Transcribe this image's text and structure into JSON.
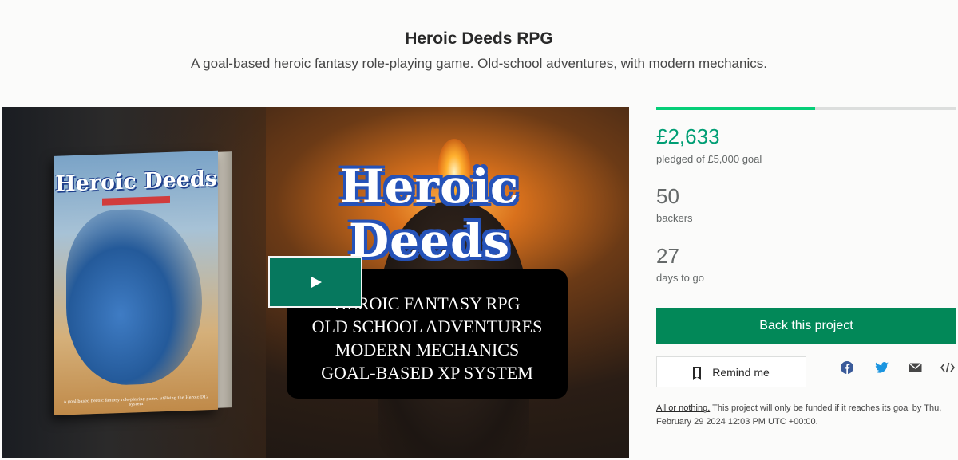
{
  "project": {
    "title": "Heroic Deeds RPG",
    "subtitle": "A goal-based heroic fantasy role-playing game. Old-school adventures, with modern mechanics."
  },
  "media": {
    "book_title": "Heroic Deeds",
    "book_tagline": "A goal-based heroic fantasy role-playing game, utilising the Heroic D12 system",
    "logo_text": "Heroic Deeds",
    "features": [
      "HEROIC FANTASY RPG",
      "OLD SCHOOL ADVENTURES",
      "MODERN MECHANICS",
      "GOAL-BASED XP SYSTEM"
    ],
    "play_icon": "play-icon"
  },
  "stats": {
    "progress_fraction": 0.53,
    "pledged_value": "£2,633",
    "pledged_label": "pledged of £5,000 goal",
    "backers_value": "50",
    "backers_label": "backers",
    "days_value": "27",
    "days_label": "days to go"
  },
  "actions": {
    "back_label": "Back this project",
    "remind_label": "Remind me",
    "share_icons": [
      "facebook-icon",
      "twitter-icon",
      "email-icon",
      "embed-icon"
    ]
  },
  "disclaimer": {
    "link_text": "All or nothing.",
    "text": " This project will only be funded if it reaches its goal by Thu, February 29 2024 12:03 PM UTC +00:00."
  },
  "colors": {
    "accent_green": "#028858",
    "pledged_green": "#009e74",
    "progress_green": "#05ce78"
  }
}
